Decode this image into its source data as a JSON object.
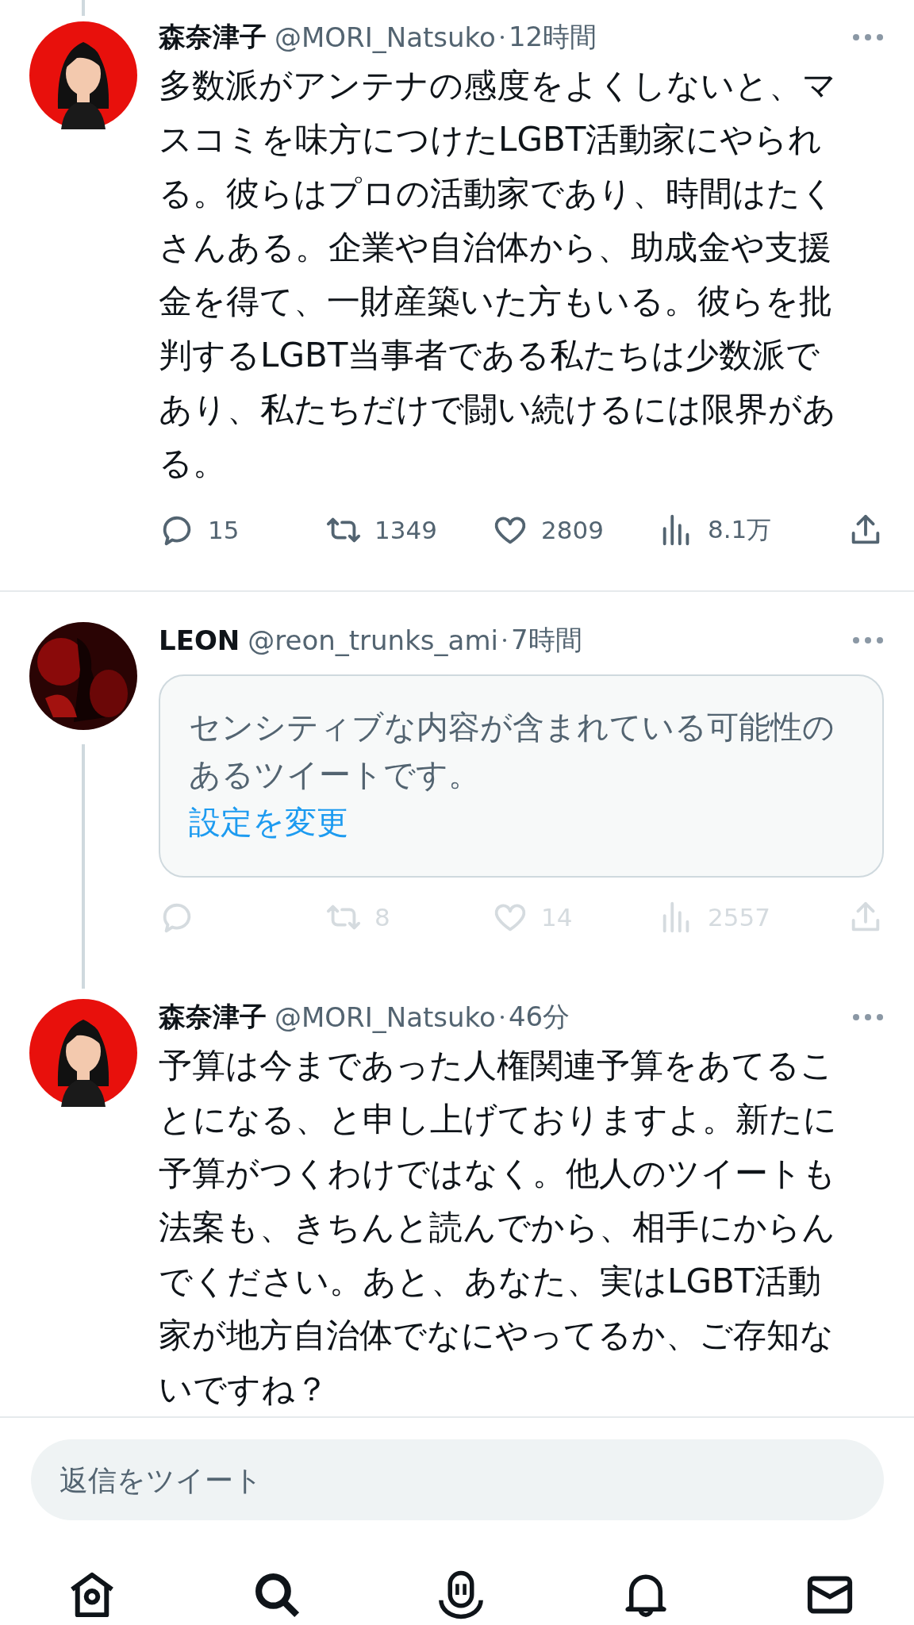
{
  "tweets": [
    {
      "kind": "text",
      "avatar": {
        "kind": "woman"
      },
      "thread_above": true,
      "thread_below": false,
      "name": "森奈津子",
      "handle": "@MORI_Natsuko",
      "time": "12時間",
      "text": "多数派がアンテナの感度をよくしないと、マスコミを味方につけたLGBT活動家にやられる。彼らはプロの活動家であり、時間はたくさんある。企業や自治体から、助成金や支援金を得て、一財産築いた方もいる。彼らを批判するLGBT当事者である私たちは少数派であり、私たちだけで闘い続けるには限界がある。",
      "divider": true,
      "actions": {
        "disabled": false,
        "replies": "15",
        "retweets": "1349",
        "likes": "2809",
        "views": "8.1万"
      }
    },
    {
      "kind": "sensitive",
      "avatar": {
        "kind": "dark"
      },
      "thread_above": false,
      "thread_below": true,
      "name": "LEON",
      "handle": "@reon_trunks_ami",
      "time": "7時間",
      "text": "センシティブな内容が含まれている可能性のあるツイートです。",
      "link": "設定を変更",
      "divider": false,
      "actions": {
        "disabled": true,
        "retweets": "8",
        "likes": "14",
        "views": "2557"
      }
    },
    {
      "kind": "text",
      "avatar": {
        "kind": "woman"
      },
      "thread_above": false,
      "thread_below": false,
      "name": "森奈津子",
      "handle": "@MORI_Natsuko",
      "time": "46分",
      "text": "予算は今まであった人権関連予算をあてることになる、と申し上げておりますよ。新たに予算がつくわけではなく。他人のツイートも法案も、きちんと読んでから、相手にからんでください。あと、あなた、実はLGBT活動家が地方自治体でなにやってるか、ご存知ないですね？",
      "divider": true
    }
  ],
  "reply_field": {
    "placeholder": "返信をツイート"
  },
  "nav": [
    {
      "kind": "home"
    },
    {
      "kind": "search"
    },
    {
      "kind": "spaces"
    },
    {
      "kind": "bell"
    },
    {
      "kind": "mail"
    }
  ]
}
